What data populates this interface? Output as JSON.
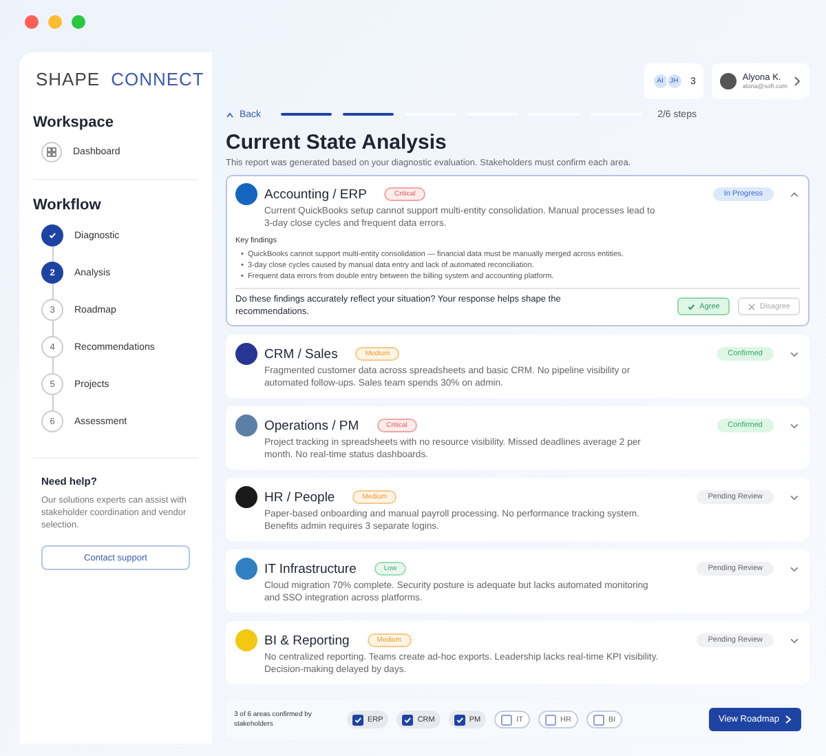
{
  "logo": {
    "left": "SHAPE",
    "right": "CONNECT"
  },
  "sidebar": {
    "workspace_heading": "Workspace",
    "workspace_items": [
      {
        "label": "Dashboard"
      }
    ],
    "workflow_heading": "Workflow",
    "steps": [
      {
        "label": "Diagnostic",
        "completed": true,
        "current": false
      },
      {
        "number": "2",
        "label": "Analysis",
        "completed": false,
        "current": true
      },
      {
        "number": "3",
        "label": "Roadmap",
        "completed": false,
        "current": false
      },
      {
        "number": "4",
        "label": "Recommendations",
        "completed": false,
        "current": false
      },
      {
        "number": "5",
        "label": "Projects",
        "completed": false,
        "current": false
      },
      {
        "number": "6",
        "label": "Assessment",
        "completed": false,
        "current": false
      }
    ],
    "help": {
      "title": "Need help?",
      "text": "Our solutions experts can assist with stakeholder coordination and vendor selection.",
      "button": "Contact support"
    }
  },
  "header": {
    "collaborators": [
      {
        "initials": "AI"
      },
      {
        "initials": "JH"
      }
    ],
    "collaborator_count": "3",
    "user": {
      "name": "Alyona K.",
      "email": "alona@soft.com"
    }
  },
  "progress": {
    "back": "Back",
    "segments": [
      {
        "filled": true
      },
      {
        "filled": true
      },
      {
        "filled": false
      },
      {
        "filled": false
      },
      {
        "filled": false
      },
      {
        "filled": false
      }
    ],
    "label": "2/6 steps"
  },
  "title": "Current State Analysis",
  "subtitle": "This report was generated based on your diagnostic evaluation. Stakeholders must confirm each area.",
  "areas": [
    {
      "title": "Accounting / ERP",
      "severity": {
        "label": "Critical",
        "kind": "critical"
      },
      "status": {
        "label": "In Progress",
        "kind": "progress"
      },
      "expanded": true,
      "color": "#1565c0",
      "description": "Current QuickBooks setup cannot support multi-entity consolidation. Manual processes lead to 3-day close cycles and frequent data errors.",
      "findings_heading": "Key findings",
      "findings": [
        {
          "bullet": "•",
          "text": "QuickBooks cannot support multi-entity consolidation — financial data must be manually merged across entities."
        },
        {
          "bullet": "•",
          "text": "3-day close cycles caused by manual data entry and lack of automated reconciliation."
        },
        {
          "bullet": "•",
          "text": "Frequent data errors from double entry between the billing system and accounting platform."
        }
      ],
      "question": "Do these findings accurately reflect your situation? Your response helps shape the recommendations.",
      "agree": "Agree",
      "disagree": "Disagree",
      "agreed": true
    },
    {
      "title": "CRM / Sales",
      "severity": {
        "label": "Medium",
        "kind": "medium"
      },
      "status": {
        "label": "Confirmed",
        "kind": "confirmed"
      },
      "expanded": false,
      "color": "#283593",
      "description": "Fragmented customer data across spreadsheets and basic CRM. No pipeline visibility or automated follow-ups. Sales team spends 30% on admin."
    },
    {
      "title": "Operations / PM",
      "severity": {
        "label": "Critical",
        "kind": "critical"
      },
      "status": {
        "label": "Confirmed",
        "kind": "confirmed"
      },
      "expanded": false,
      "color": "#5c7fa8",
      "description": "Project tracking in spreadsheets with no resource visibility. Missed deadlines average 2 per month. No real-time status dashboards."
    },
    {
      "title": "HR / People",
      "severity": {
        "label": "Medium",
        "kind": "medium"
      },
      "status": {
        "label": "Pending Review",
        "kind": "pending"
      },
      "expanded": false,
      "color": "#1a1a1a",
      "description": "Paper-based onboarding and manual payroll processing. No performance tracking system. Benefits admin requires 3 separate logins."
    },
    {
      "title": "IT Infrastructure",
      "severity": {
        "label": "Low",
        "kind": "low"
      },
      "status": {
        "label": "Pending Review",
        "kind": "pending"
      },
      "expanded": false,
      "color": "#2f7fc1",
      "description": "Cloud migration 70% complete. Security posture is adequate but lacks automated monitoring and SSO integration across platforms."
    },
    {
      "title": "BI & Reporting",
      "severity": {
        "label": "Medium",
        "kind": "medium"
      },
      "status": {
        "label": "Pending Review",
        "kind": "pending"
      },
      "expanded": false,
      "color": "#f2c811",
      "description": "No centralized reporting. Teams create ad-hoc exports. Leadership lacks real-time KPI visibility. Decision-making delayed by days."
    }
  ],
  "footer": {
    "summary": "3 of 6 areas confirmed by stakeholders",
    "chips": [
      {
        "label": "ERP",
        "checked": true
      },
      {
        "label": "CRM",
        "checked": true
      },
      {
        "label": "PM",
        "checked": true
      },
      {
        "label": "IT",
        "checked": false
      },
      {
        "label": "HR",
        "checked": false
      },
      {
        "label": "BI",
        "checked": false
      }
    ],
    "button": "View Roadmap"
  }
}
